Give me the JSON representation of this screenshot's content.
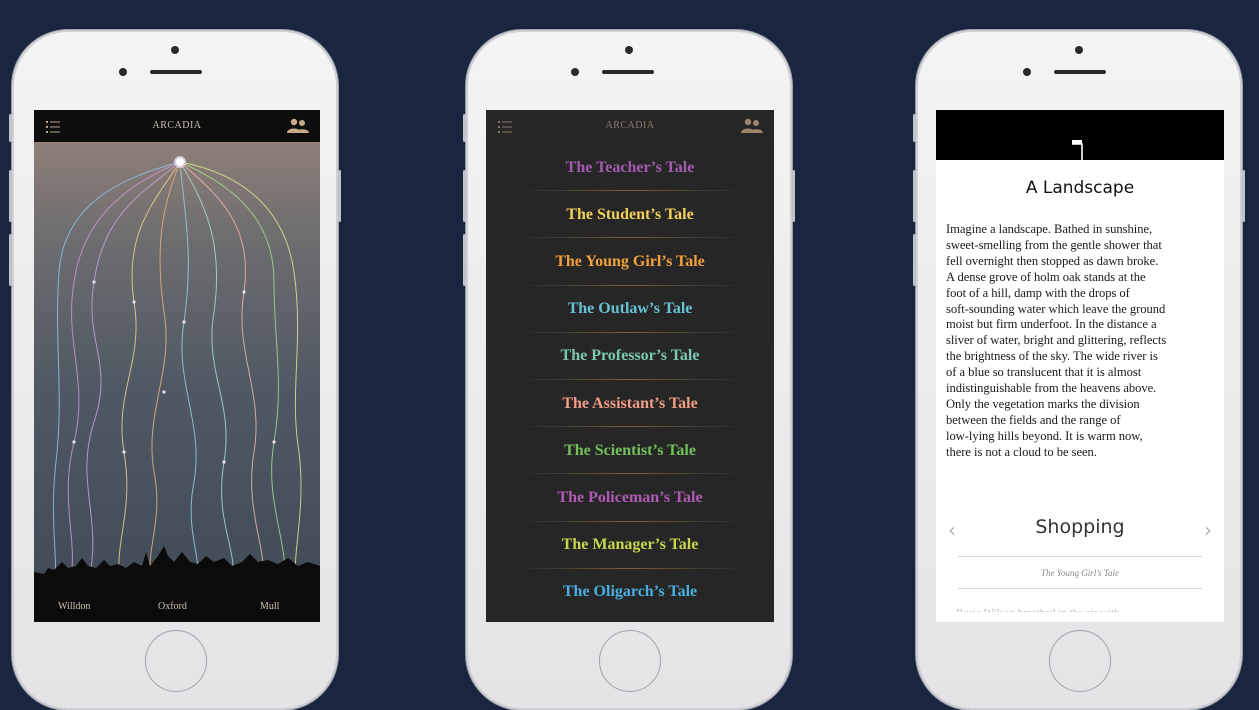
{
  "colors": {
    "page_bg": "#1a2540",
    "screen_dark": "#262626",
    "map_gradient_top": "#8f7f78",
    "map_gradient_bottom": "#414b57"
  },
  "phone1": {
    "app_title": "ARCADIA",
    "menu_icon": "list-icon",
    "characters_icon": "people-icon",
    "locations": [
      "Willdon",
      "Oxford",
      "Mull"
    ]
  },
  "phone2": {
    "app_title": "ARCADIA",
    "tales": [
      {
        "label": "The Teacher’s Tale",
        "color": "#a55bb2"
      },
      {
        "label": "The Student’s Tale",
        "color": "#f2cf5a"
      },
      {
        "label": "The Young Girl’s Tale",
        "color": "#f3a13a"
      },
      {
        "label": "The Outlaw’s Tale",
        "color": "#66c3d2"
      },
      {
        "label": "The Professor’s Tale",
        "color": "#7bc8b3"
      },
      {
        "label": "The Assistant’s Tale",
        "color": "#f29d84"
      },
      {
        "label": "The Scientist’s Tale",
        "color": "#73c05a"
      },
      {
        "label": "The Policeman’s Tale",
        "color": "#b159b4"
      },
      {
        "label": "The Manager’s Tale",
        "color": "#c7d64b"
      },
      {
        "label": "The Oligarch’s Tale",
        "color": "#49aee2"
      }
    ]
  },
  "phone3": {
    "bookmark_icon": "bookmark-icon",
    "story_title": "A Landscape",
    "story_lines": [
      "Imagine a landscape.  Bathed in sunshine,",
      "sweet-smelling from the gentle shower that",
      "fell overnight then stopped as dawn broke.",
      "A dense grove of holm oak stands at the",
      "foot of a hill, damp with the drops of",
      "soft-sounding water which leave the ground",
      "moist but firm underfoot.  In the distance a",
      "sliver of water, bright and glittering, reflects",
      "the brightness of the sky.  The wide river is",
      "of a blue so translucent that it is almost",
      "indistinguishable from the heavens above.",
      "Only the vegetation marks the division",
      "between the fields and the range of",
      "low-lying hills beyond.  It is warm now,",
      "there is not a cloud to be seen."
    ],
    "nav_label": "Shopping",
    "prev_icon": "chevron-left-icon",
    "next_icon": "chevron-right-icon",
    "sub_caption": "The Young Girl’s Tale",
    "cut_text": "Rosie Wilson breathed in the air with"
  }
}
